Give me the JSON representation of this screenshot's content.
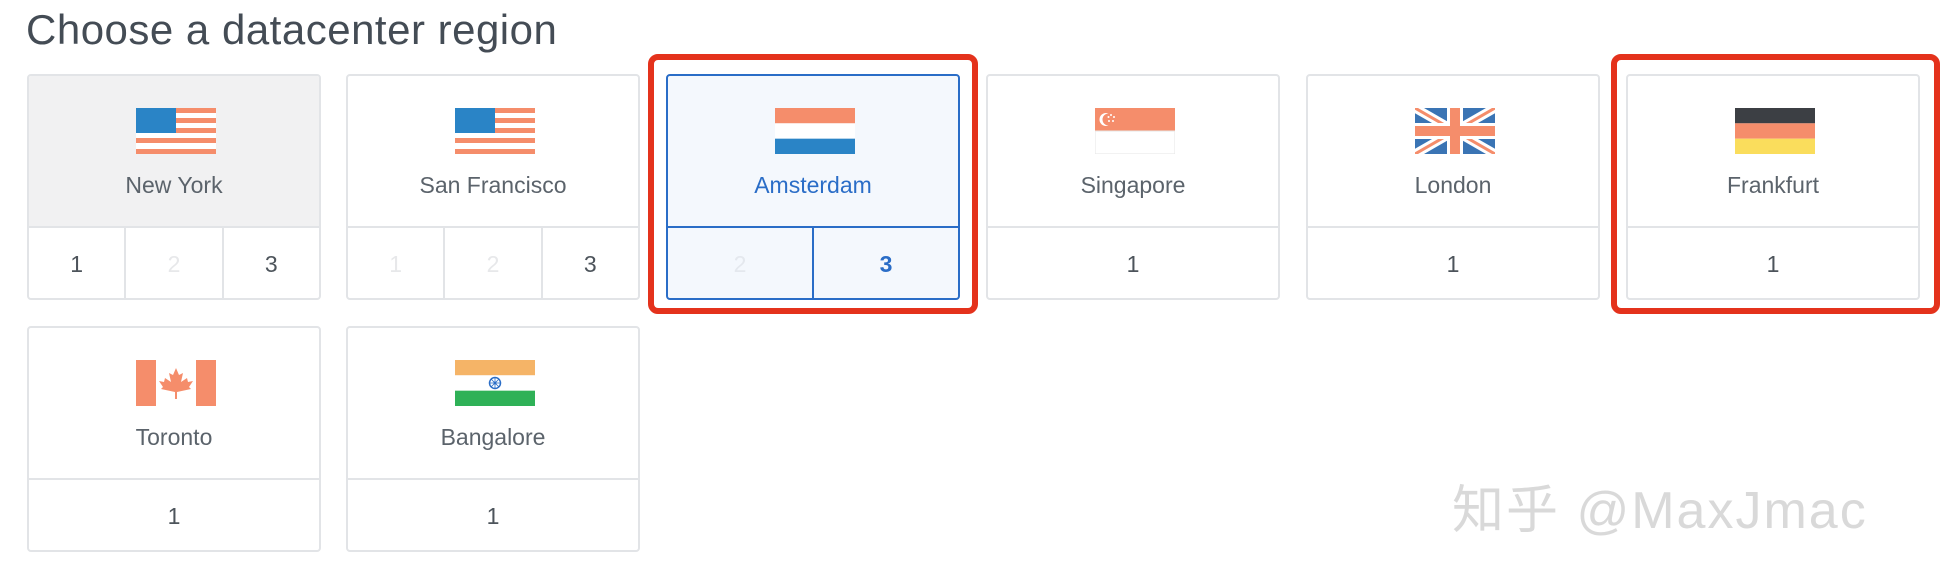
{
  "page": {
    "title": "Choose a datacenter region"
  },
  "regions": [
    {
      "name": "New York",
      "flag": "usa-flag-icon",
      "numbers": [
        "1",
        "2",
        "3"
      ]
    },
    {
      "name": "San Francisco",
      "flag": "usa-flag-icon",
      "numbers": [
        "1",
        "2",
        "3"
      ]
    },
    {
      "name": "Amsterdam",
      "flag": "netherlands-flag-icon",
      "numbers": [
        "2",
        "3"
      ],
      "selected": true
    },
    {
      "name": "Singapore",
      "flag": "singapore-flag-icon",
      "numbers": [
        "1"
      ]
    },
    {
      "name": "London",
      "flag": "uk-flag-icon",
      "numbers": [
        "1"
      ]
    },
    {
      "name": "Frankfurt",
      "flag": "germany-flag-icon",
      "numbers": [
        "1"
      ]
    },
    {
      "name": "Toronto",
      "flag": "canada-flag-icon",
      "numbers": [
        "1"
      ]
    },
    {
      "name": "Bangalore",
      "flag": "india-flag-icon",
      "numbers": [
        "1"
      ]
    }
  ],
  "watermark": "知乎 @MaxJmac",
  "colors": {
    "selected_blue": "#2a6dc7",
    "highlight_red": "#e4321c",
    "border_gray": "#e2e4e7",
    "text_gray": "#5b636b"
  }
}
